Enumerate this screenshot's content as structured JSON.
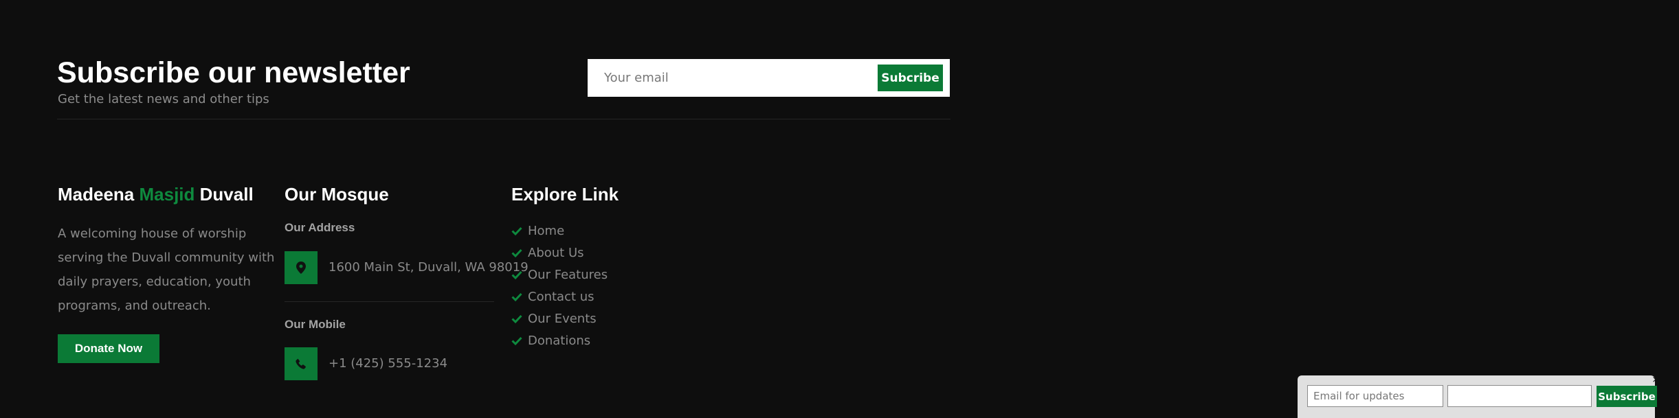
{
  "newsletter": {
    "title": "Subscribe our newsletter",
    "subtitle": "Get the latest news and other tips",
    "email_placeholder": "Your email",
    "button_label": "Subcribe"
  },
  "about": {
    "title_part1": "Madeena ",
    "title_part2": "Masjid",
    "title_part3": " Duvall",
    "description": "A welcoming house of worship serving the Duvall community with daily prayers, education, youth programs, and outreach.",
    "donate_label": "Donate Now"
  },
  "mosque": {
    "title": "Our Mosque",
    "address_label": "Our Address",
    "address": "1600 Main St, Duvall, WA 98019",
    "address_icon": "map-pin-icon",
    "mobile_label": "Our Mobile",
    "mobile": "+1 (425) 555-1234",
    "mobile_icon": "phone-icon"
  },
  "explore": {
    "title": "Explore Link",
    "items": [
      {
        "label": "Home"
      },
      {
        "label": "About Us"
      },
      {
        "label": "Our Features"
      },
      {
        "label": "Contact us"
      },
      {
        "label": "Our Events"
      },
      {
        "label": "Donations"
      }
    ]
  },
  "float_bar": {
    "email_placeholder": "Email for updates",
    "button_label": "Subscribe",
    "close_symbol": "×"
  },
  "colors": {
    "background": "#0e0e0e",
    "accent": "#0b7a36",
    "highlight_text": "#0e8a3e"
  }
}
